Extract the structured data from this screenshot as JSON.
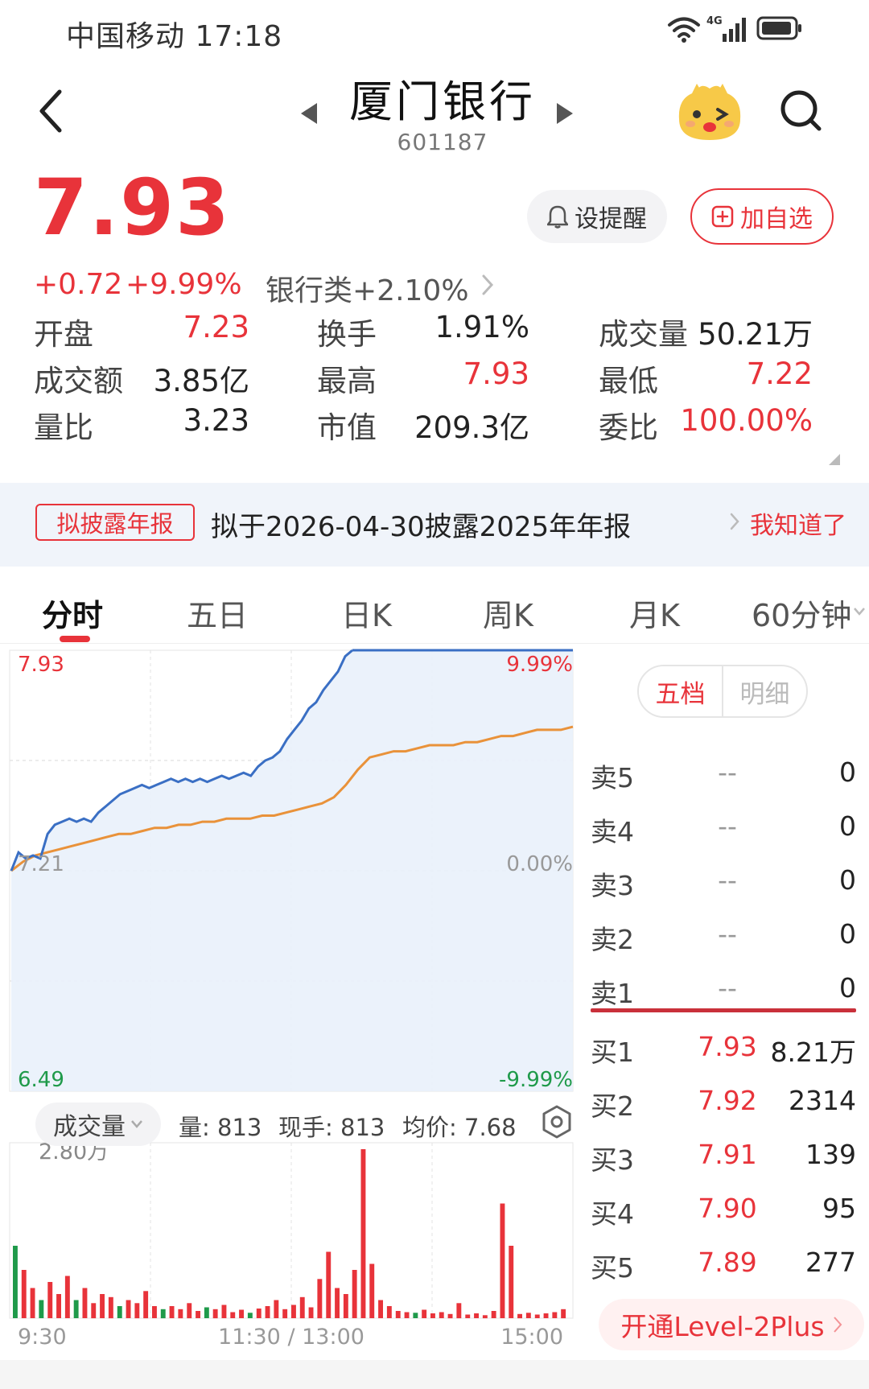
{
  "status_bar": {
    "carrier": "中国移动",
    "time": "17:18",
    "network": "4G"
  },
  "header": {
    "stock_name": "厦门银行",
    "stock_code": "601187"
  },
  "quote": {
    "price": "7.93",
    "change_abs": "+0.72",
    "change_pct": "+9.99%",
    "sector": "银行类+2.10%",
    "alert_label": "设提醒",
    "add_watchlist_label": "加自选"
  },
  "stats": [
    {
      "label": "开盘",
      "value": "7.23",
      "color": "red"
    },
    {
      "label": "换手",
      "value": "1.91%",
      "color": "dark"
    },
    {
      "label": "成交量",
      "value": "50.21万",
      "color": "dark"
    },
    {
      "label": "成交额",
      "value": "3.85亿",
      "color": "dark"
    },
    {
      "label": "最高",
      "value": "7.93",
      "color": "red"
    },
    {
      "label": "最低",
      "value": "7.22",
      "color": "red"
    },
    {
      "label": "量比",
      "value": "3.23",
      "color": "dark"
    },
    {
      "label": "市值",
      "value": "209.3亿",
      "color": "dark"
    },
    {
      "label": "委比",
      "value": "100.00%",
      "color": "red"
    }
  ],
  "notice": {
    "tag": "拟披露年报",
    "text": "拟于2026-04-30披露2025年年报",
    "ack": "我知道了"
  },
  "tabs": [
    "分时",
    "五日",
    "日K",
    "周K",
    "月K",
    "60分钟"
  ],
  "active_tab": "分时",
  "chart_data": {
    "type": "line",
    "price_axis": {
      "top": "7.93",
      "mid": "7.21",
      "bottom": "6.49"
    },
    "pct_axis": {
      "top": "9.99%",
      "mid": "0.00%",
      "bottom": "-9.99%"
    },
    "ylim": [
      6.49,
      7.93
    ],
    "x_ticks": [
      "9:30",
      "11:30 / 13:00",
      "15:00"
    ],
    "series": [
      {
        "name": "price",
        "color": "#3a6fc4",
        "values": [
          7.21,
          7.27,
          7.25,
          7.26,
          7.25,
          7.33,
          7.36,
          7.37,
          7.38,
          7.37,
          7.38,
          7.37,
          7.4,
          7.42,
          7.44,
          7.46,
          7.47,
          7.48,
          7.49,
          7.48,
          7.49,
          7.5,
          7.51,
          7.5,
          7.51,
          7.5,
          7.51,
          7.5,
          7.51,
          7.52,
          7.51,
          7.52,
          7.53,
          7.52,
          7.55,
          7.57,
          7.58,
          7.6,
          7.64,
          7.67,
          7.7,
          7.74,
          7.76,
          7.8,
          7.83,
          7.86,
          7.91,
          7.93
        ]
      },
      {
        "name": "avg",
        "color": "#e9923a",
        "values": [
          7.21,
          7.24,
          7.26,
          7.27,
          7.28,
          7.29,
          7.3,
          7.31,
          7.32,
          7.33,
          7.33,
          7.34,
          7.35,
          7.35,
          7.36,
          7.36,
          7.37,
          7.37,
          7.38,
          7.38,
          7.38,
          7.39,
          7.39,
          7.4,
          7.41,
          7.42,
          7.43,
          7.45,
          7.49,
          7.54,
          7.58,
          7.59,
          7.6,
          7.6,
          7.61,
          7.62,
          7.62,
          7.62,
          7.63,
          7.63,
          7.64,
          7.65,
          7.65,
          7.66,
          7.67,
          7.67,
          7.67,
          7.68
        ]
      }
    ]
  },
  "volume": {
    "selector": "成交量",
    "qty": "量: 813",
    "current": "现手: 813",
    "avg_price": "均价: 7.68",
    "max_label": "2.80万",
    "max": 28000,
    "bars": [
      {
        "v": 12000,
        "c": "green"
      },
      {
        "v": 8000,
        "c": "red"
      },
      {
        "v": 5000,
        "c": "red"
      },
      {
        "v": 3000,
        "c": "green"
      },
      {
        "v": 6000,
        "c": "red"
      },
      {
        "v": 4000,
        "c": "red"
      },
      {
        "v": 7000,
        "c": "red"
      },
      {
        "v": 3000,
        "c": "green"
      },
      {
        "v": 5000,
        "c": "red"
      },
      {
        "v": 2500,
        "c": "red"
      },
      {
        "v": 4000,
        "c": "red"
      },
      {
        "v": 3500,
        "c": "red"
      },
      {
        "v": 2000,
        "c": "green"
      },
      {
        "v": 3000,
        "c": "red"
      },
      {
        "v": 2500,
        "c": "red"
      },
      {
        "v": 4500,
        "c": "red"
      },
      {
        "v": 2000,
        "c": "red"
      },
      {
        "v": 1500,
        "c": "green"
      },
      {
        "v": 2000,
        "c": "red"
      },
      {
        "v": 1500,
        "c": "red"
      },
      {
        "v": 2500,
        "c": "red"
      },
      {
        "v": 1200,
        "c": "red"
      },
      {
        "v": 1800,
        "c": "green"
      },
      {
        "v": 1500,
        "c": "red"
      },
      {
        "v": 2200,
        "c": "red"
      },
      {
        "v": 1000,
        "c": "red"
      },
      {
        "v": 1400,
        "c": "red"
      },
      {
        "v": 900,
        "c": "green"
      },
      {
        "v": 1600,
        "c": "red"
      },
      {
        "v": 2000,
        "c": "red"
      },
      {
        "v": 3000,
        "c": "red"
      },
      {
        "v": 1500,
        "c": "red"
      },
      {
        "v": 2200,
        "c": "red"
      },
      {
        "v": 3500,
        "c": "red"
      },
      {
        "v": 1800,
        "c": "red"
      },
      {
        "v": 6500,
        "c": "red"
      },
      {
        "v": 11000,
        "c": "red"
      },
      {
        "v": 5000,
        "c": "red"
      },
      {
        "v": 4000,
        "c": "red"
      },
      {
        "v": 8000,
        "c": "red"
      },
      {
        "v": 28000,
        "c": "red"
      },
      {
        "v": 9000,
        "c": "red"
      },
      {
        "v": 3000,
        "c": "red"
      },
      {
        "v": 2000,
        "c": "red"
      },
      {
        "v": 1200,
        "c": "red"
      },
      {
        "v": 1000,
        "c": "red"
      },
      {
        "v": 900,
        "c": "green"
      },
      {
        "v": 1400,
        "c": "red"
      },
      {
        "v": 800,
        "c": "red"
      },
      {
        "v": 1000,
        "c": "red"
      },
      {
        "v": 700,
        "c": "red"
      },
      {
        "v": 2500,
        "c": "red"
      },
      {
        "v": 600,
        "c": "red"
      },
      {
        "v": 800,
        "c": "red"
      },
      {
        "v": 500,
        "c": "red"
      },
      {
        "v": 1200,
        "c": "red"
      },
      {
        "v": 19000,
        "c": "red"
      },
      {
        "v": 12000,
        "c": "red"
      },
      {
        "v": 700,
        "c": "red"
      },
      {
        "v": 900,
        "c": "red"
      },
      {
        "v": 600,
        "c": "red"
      },
      {
        "v": 800,
        "c": "red"
      },
      {
        "v": 1000,
        "c": "red"
      },
      {
        "v": 1500,
        "c": "red"
      }
    ]
  },
  "order_book": {
    "tabs": [
      "五档",
      "明细"
    ],
    "active": "五档",
    "asks": [
      {
        "label": "卖5",
        "price": "--",
        "vol": "0"
      },
      {
        "label": "卖4",
        "price": "--",
        "vol": "0"
      },
      {
        "label": "卖3",
        "price": "--",
        "vol": "0"
      },
      {
        "label": "卖2",
        "price": "--",
        "vol": "0"
      },
      {
        "label": "卖1",
        "price": "--",
        "vol": "0"
      }
    ],
    "bids": [
      {
        "label": "买1",
        "price": "7.93",
        "vol": "8.21万"
      },
      {
        "label": "买2",
        "price": "7.92",
        "vol": "2314"
      },
      {
        "label": "买3",
        "price": "7.91",
        "vol": "139"
      },
      {
        "label": "买4",
        "price": "7.90",
        "vol": "95"
      },
      {
        "label": "买5",
        "price": "7.89",
        "vol": "277"
      }
    ],
    "level2_label": "开通Level-2Plus"
  },
  "colors": {
    "up": "#e8333a",
    "down": "#1f9a4a",
    "price_line": "#3a6fc4",
    "avg_line": "#e9923a"
  }
}
